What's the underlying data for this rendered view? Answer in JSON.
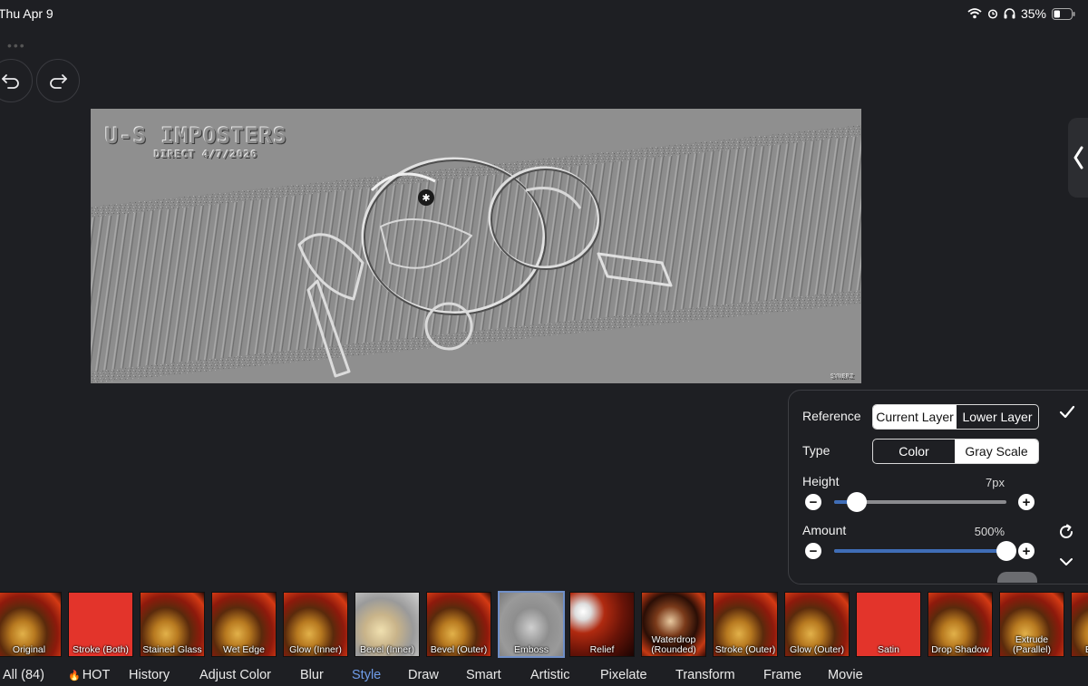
{
  "status": {
    "time": "Thu Apr 9",
    "battery": "35%"
  },
  "canvas": {
    "title_text": "U-S IMPOSTERS",
    "subtitle_text": "DIRECT 4/7/2026",
    "signature_text": "SYNERZ"
  },
  "panel": {
    "reference_label": "Reference",
    "reference_options": [
      "Current Layer",
      "Lower Layer"
    ],
    "reference_selected": "Current Layer",
    "type_label": "Type",
    "type_options": [
      "Color",
      "Gray Scale"
    ],
    "type_selected": "Gray Scale",
    "height_label": "Height",
    "height_value": "7px",
    "height_fraction": 0.13,
    "amount_label": "Amount",
    "amount_value": "500%",
    "amount_fraction": 1.0,
    "minus": "−",
    "plus": "+"
  },
  "filters": [
    {
      "label": "Original",
      "style": "photo"
    },
    {
      "label": "Stroke (Both)",
      "style": "red"
    },
    {
      "label": "Stained Glass",
      "style": "photo"
    },
    {
      "label": "Wet Edge",
      "style": "photo"
    },
    {
      "label": "Glow (Inner)",
      "style": "photo"
    },
    {
      "label": "Bevel (Inner)",
      "style": "bevel"
    },
    {
      "label": "Bevel (Outer)",
      "style": "photo"
    },
    {
      "label": "Emboss",
      "style": "emboss",
      "selected": true
    },
    {
      "label": "Relief",
      "style": "relief"
    },
    {
      "label": "Waterdrop (Rounded)",
      "style": "waterdrop"
    },
    {
      "label": "Stroke (Outer)",
      "style": "photo"
    },
    {
      "label": "Glow (Outer)",
      "style": "photo"
    },
    {
      "label": "Satin",
      "style": "red"
    },
    {
      "label": "Drop Shadow",
      "style": "photo"
    },
    {
      "label": "Extrude (Parallel)",
      "style": "photo"
    },
    {
      "label": "Ex (Pers",
      "style": "photo"
    }
  ],
  "tabs": [
    "All (84)",
    "HOT",
    "History",
    "Adjust Color",
    "Blur",
    "Style",
    "Draw",
    "Smart",
    "Artistic",
    "Pixelate",
    "Transform",
    "Frame",
    "Movie"
  ],
  "active_tab": "Style",
  "colors": {
    "accent": "#6f9ce8",
    "slider_fill": "#3f6db7",
    "satin_red": "#e3342b"
  }
}
